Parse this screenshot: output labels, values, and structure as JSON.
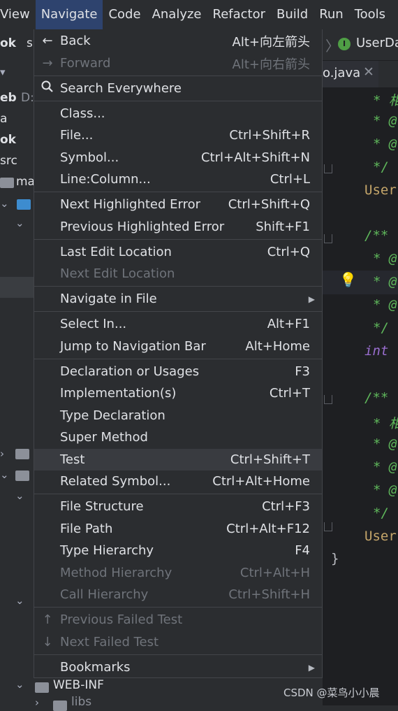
{
  "menubar": {
    "items": [
      "View",
      "Navigate",
      "Code",
      "Analyze",
      "Refactor",
      "Build",
      "Run",
      "Tools"
    ]
  },
  "breadcrumb": {
    "file": "UserDa"
  },
  "editor_tab": {
    "label": "o.java"
  },
  "project_tree": {
    "fragments": [
      "ok",
      "s",
      "eb",
      "D:",
      "a",
      "ok",
      "src",
      "ma"
    ],
    "bottom_folder": "WEB-INF",
    "bottom_sub": "libs"
  },
  "code": {
    "lines": [
      "* 相",
      "* @",
      "* @",
      "*/",
      "User",
      "/**",
      "* @",
      "* @",
      "* @",
      "*/",
      "int",
      "/**",
      "* 相",
      "* @",
      "* @",
      "* @",
      "*/",
      "User",
      "}"
    ]
  },
  "menu": {
    "back": {
      "label": "Back",
      "shortcut": "Alt+向左箭头"
    },
    "forward": {
      "label": "Forward",
      "shortcut": "Alt+向右箭头"
    },
    "search_everywhere": {
      "label": "Search Everywhere"
    },
    "class": {
      "label": "Class..."
    },
    "file": {
      "label": "File...",
      "shortcut": "Ctrl+Shift+R"
    },
    "symbol": {
      "label": "Symbol...",
      "shortcut": "Ctrl+Alt+Shift+N"
    },
    "line_column": {
      "label": "Line:Column...",
      "shortcut": "Ctrl+L"
    },
    "next_highlighted_error": {
      "label": "Next Highlighted Error",
      "shortcut": "Ctrl+Shift+Q"
    },
    "previous_highlighted_error": {
      "label": "Previous Highlighted Error",
      "shortcut": "Shift+F1"
    },
    "last_edit_location": {
      "label": "Last Edit Location",
      "shortcut": "Ctrl+Q"
    },
    "next_edit_location": {
      "label": "Next Edit Location"
    },
    "navigate_in_file": {
      "label": "Navigate in File"
    },
    "select_in": {
      "label": "Select In...",
      "shortcut": "Alt+F1"
    },
    "jump_to_navigation_bar": {
      "label": "Jump to Navigation Bar",
      "shortcut": "Alt+Home"
    },
    "declaration_or_usages": {
      "label": "Declaration or Usages",
      "shortcut": "F3"
    },
    "implementations": {
      "label": "Implementation(s)",
      "shortcut": "Ctrl+T"
    },
    "type_declaration": {
      "label": "Type Declaration"
    },
    "super_method": {
      "label": "Super Method"
    },
    "test": {
      "label": "Test",
      "shortcut": "Ctrl+Shift+T"
    },
    "related_symbol": {
      "label": "Related Symbol...",
      "shortcut": "Ctrl+Alt+Home"
    },
    "file_structure": {
      "label": "File Structure",
      "shortcut": "Ctrl+F3"
    },
    "file_path": {
      "label": "File Path",
      "shortcut": "Ctrl+Alt+F12"
    },
    "type_hierarchy": {
      "label": "Type Hierarchy",
      "shortcut": "F4"
    },
    "method_hierarchy": {
      "label": "Method Hierarchy",
      "shortcut": "Ctrl+Alt+H"
    },
    "call_hierarchy": {
      "label": "Call Hierarchy",
      "shortcut": "Ctrl+Shift+H"
    },
    "previous_failed_test": {
      "label": "Previous Failed Test"
    },
    "next_failed_test": {
      "label": "Next Failed Test"
    },
    "bookmarks": {
      "label": "Bookmarks"
    }
  },
  "watermark": "CSDN @菜鸟小小晨",
  "colors": {
    "menu_bg": "#2b2d30",
    "menu_selected": "#393b40",
    "menubar_active": "#2e436e",
    "disabled_text": "#6f737a",
    "comment_green": "#5fb85b"
  }
}
